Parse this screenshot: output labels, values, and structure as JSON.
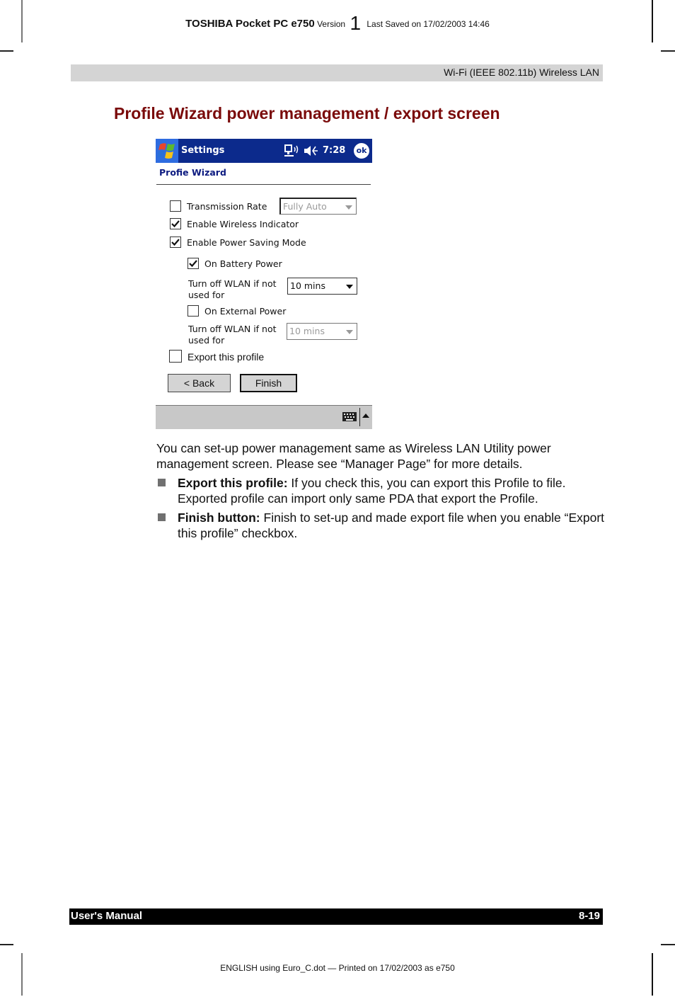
{
  "header": {
    "product": "TOSHIBA Pocket PC e750",
    "version_label": "Version",
    "version_number": "1",
    "last_saved": "Last Saved on 17/02/2003 14:46"
  },
  "section_band": "Wi-Fi (IEEE 802.11b) Wireless LAN",
  "page_title": "Profile Wizard power management / export screen",
  "device_screen": {
    "titlebar": {
      "app_title": "Settings",
      "time": "7:28",
      "ok_label": "ok",
      "icons": [
        "windows-start-icon",
        "wireless-connection-icon",
        "speaker-volume-icon"
      ]
    },
    "subtitle": "Profie Wizard",
    "transmission_rate": {
      "label": "Transmission Rate",
      "checked": false,
      "select_value": "Fully Auto",
      "select_enabled": false
    },
    "enable_wireless_indicator": {
      "label": "Enable Wireless Indicator",
      "checked": true
    },
    "enable_power_saving": {
      "label": "Enable Power Saving Mode",
      "checked": true
    },
    "on_battery_power": {
      "label": "On Battery Power",
      "checked": true
    },
    "battery_turn_off": {
      "label_line1": "Turn off WLAN if not",
      "label_line2": "used for",
      "select_value": "10 mins",
      "select_enabled": true
    },
    "on_external_power": {
      "label": "On External Power",
      "checked": false
    },
    "external_turn_off": {
      "label_line1": "Turn off WLAN if not",
      "label_line2": "used for",
      "select_value": "10 mins",
      "select_enabled": false
    },
    "export_profile": {
      "label": "Export this profile",
      "checked": false
    },
    "buttons": {
      "back": "< Back",
      "finish": "Finish"
    },
    "bottombar_icons": [
      "keyboard-icon",
      "sip-up-arrow-icon"
    ]
  },
  "body": {
    "intro": "You can set-up power management same as Wireless LAN Utility power management screen. Please see “Manager Page” for more details.",
    "bullets": [
      {
        "term": "Export this profile:",
        "text": " If you check this, you can export this Profile to file. Exported profile can import only same PDA that export the Profile."
      },
      {
        "term": "Finish button:",
        "text": " Finish to set-up and made export file when you enable “Export this profile” checkbox."
      }
    ]
  },
  "footer": {
    "left": "User's Manual",
    "right": "8-19",
    "print_info": "ENGLISH using Euro_C.dot — Printed on 17/02/2003 as e750"
  },
  "colors": {
    "title_red": "#7a0a0a",
    "ppc_titlebar_blue": "#0c2a8c",
    "band_gray": "#d4d4d4"
  }
}
